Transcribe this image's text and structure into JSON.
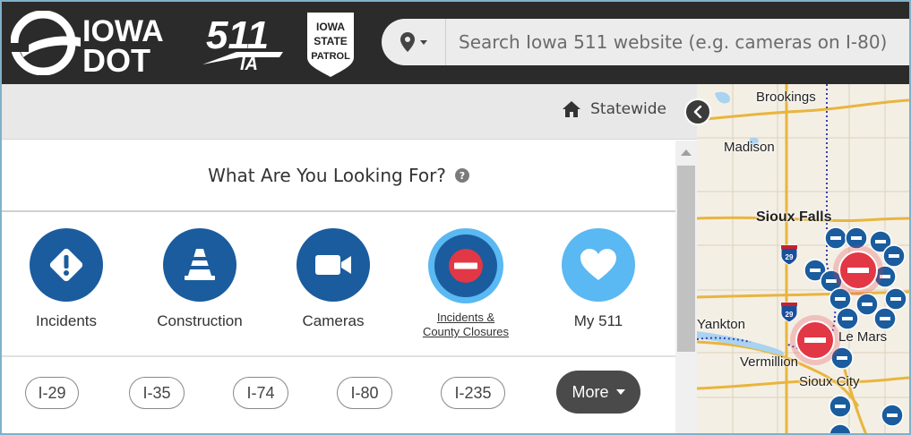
{
  "header": {
    "logo_iowa_dot": {
      "line1": "IOWA",
      "line2": "DOT"
    },
    "logo_511": {
      "number": "511",
      "subtext": "IA"
    },
    "logo_patrol": {
      "line1": "IOWA",
      "line2": "STATE",
      "line3": "PATROL"
    },
    "search": {
      "placeholder": "Search Iowa 511 website (e.g. cameras on I-80)"
    }
  },
  "panel": {
    "statewide_label": "Statewide",
    "question": "What Are You Looking For?",
    "help_symbol": "?",
    "categories": [
      {
        "label": "Incidents",
        "icon": "warning-diamond-icon",
        "color": "#1a5c9e"
      },
      {
        "label": "Construction",
        "icon": "traffic-cone-icon",
        "color": "#1a5c9e"
      },
      {
        "label": "Cameras",
        "icon": "camera-icon",
        "color": "#1a5c9e"
      },
      {
        "label": "Incidents &",
        "label2": "County Closures",
        "icon": "road-closed-icon",
        "color": "#1a5c9e",
        "accent": "#e23744",
        "selected": true
      },
      {
        "label": "My 511",
        "icon": "heart-icon",
        "color": "#5ab8f2"
      }
    ],
    "routes": [
      "I-29",
      "I-35",
      "I-74",
      "I-80",
      "I-235"
    ],
    "more_label": "More"
  },
  "map": {
    "cities": [
      "Brookings",
      "Madison",
      "Sioux Falls",
      "Yankton",
      "Le Mars",
      "Vermillion",
      "Sioux City"
    ],
    "highway_shields": [
      "29",
      "29"
    ]
  }
}
